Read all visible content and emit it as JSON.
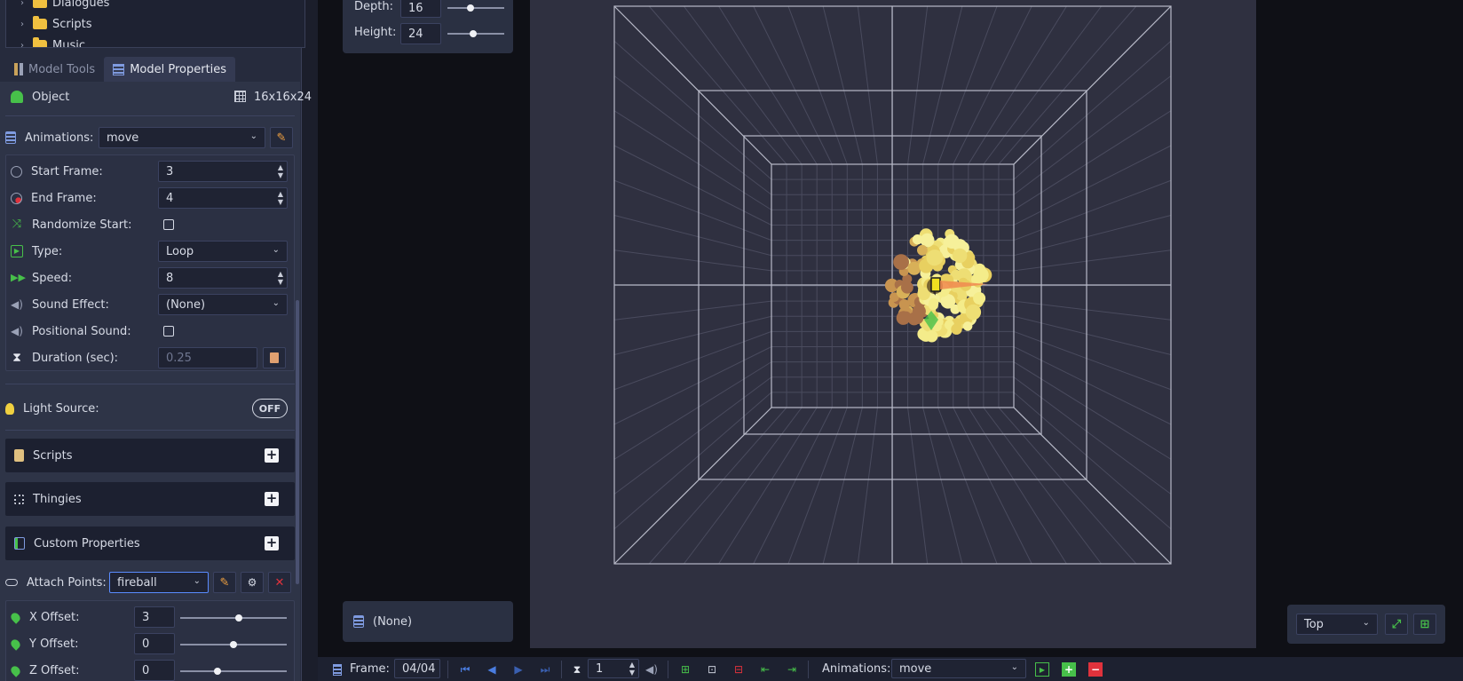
{
  "tree": {
    "items": [
      {
        "label": "Dialogues"
      },
      {
        "label": "Scripts"
      },
      {
        "label": "Music"
      }
    ]
  },
  "tabs": [
    {
      "label": "Model Tools",
      "active": false
    },
    {
      "label": "Model Properties",
      "active": true
    }
  ],
  "object": {
    "label": "Object",
    "size": "16x16x24"
  },
  "animations": {
    "label": "Animations:",
    "value": "move"
  },
  "anim_props": {
    "start_frame": {
      "label": "Start Frame:",
      "value": "3"
    },
    "end_frame": {
      "label": "End Frame:",
      "value": "4"
    },
    "randomize_start": {
      "label": "Randomize Start:",
      "checked": false
    },
    "type": {
      "label": "Type:",
      "value": "Loop"
    },
    "speed": {
      "label": "Speed:",
      "value": "8"
    },
    "sound_effect": {
      "label": "Sound Effect:",
      "value": "(None)"
    },
    "positional_sound": {
      "label": "Positional Sound:",
      "checked": false
    },
    "duration": {
      "label": "Duration (sec):",
      "value": "0.25"
    }
  },
  "light_source": {
    "label": "Light Source:",
    "toggle": "OFF"
  },
  "groups": {
    "scripts": "Scripts",
    "thingies": "Thingies",
    "custom_properties": "Custom Properties"
  },
  "attach_points": {
    "label": "Attach Points:",
    "value": "fireball"
  },
  "offsets": {
    "x": {
      "label": "X Offset:",
      "value": "3",
      "fraction": 0.55
    },
    "y": {
      "label": "Y Offset:",
      "value": "0",
      "fraction": 0.5
    },
    "z": {
      "label": "Z Offset:",
      "value": "0",
      "fraction": 0.35
    }
  },
  "dimensions": {
    "depth": {
      "label": "Depth:",
      "value": "16",
      "fraction": 0.4
    },
    "height": {
      "label": "Height:",
      "value": "24",
      "fraction": 0.45
    }
  },
  "attach_model": {
    "value": "(None)"
  },
  "view": {
    "value": "Top"
  },
  "toolbar": {
    "frame_label": "Frame:",
    "frame_value": "04/04",
    "duration_value": "1",
    "animations_label": "Animations:",
    "animations_value": "move"
  },
  "colors": {
    "accent_green": "#47c04a",
    "accent_red": "#e0323c",
    "accent_yellow": "#f0c040",
    "accent_blue": "#4a7de0"
  }
}
